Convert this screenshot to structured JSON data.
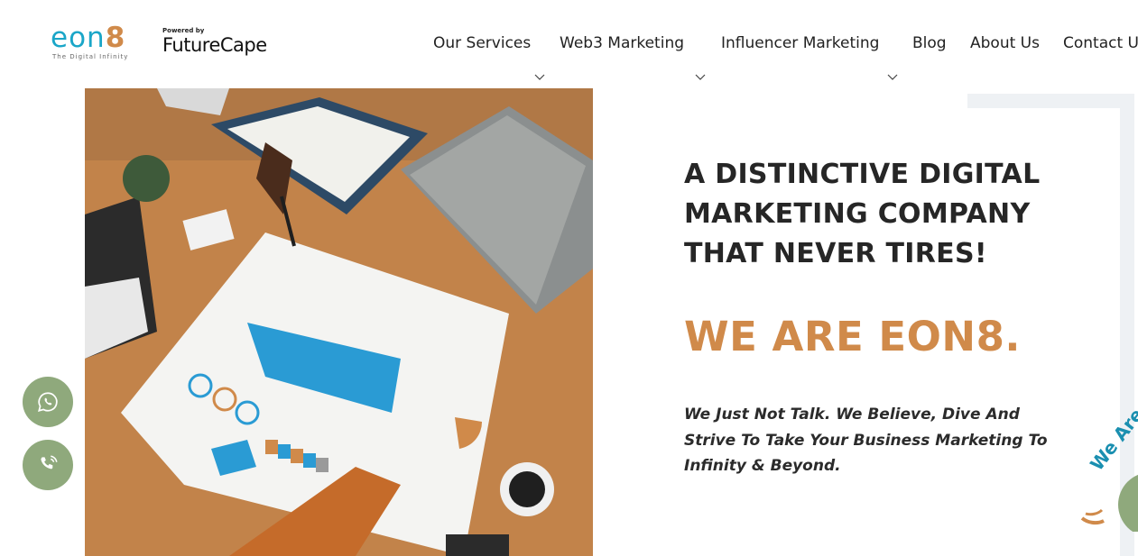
{
  "brand": {
    "logo_text": "eon",
    "logo_digit": "8",
    "logo_tagline": "The Digital Infinity",
    "powered_label": "Powered by",
    "powered_name": "FutureCape"
  },
  "nav": {
    "items": [
      {
        "label": "Our Services",
        "has_dropdown": true
      },
      {
        "label": "Web3 Marketing",
        "has_dropdown": true
      },
      {
        "label": "Influencer Marketing",
        "has_dropdown": true
      },
      {
        "label": "Blog",
        "has_dropdown": false
      },
      {
        "label": "About Us",
        "has_dropdown": false
      },
      {
        "label": "Contact Us",
        "has_dropdown": false
      }
    ]
  },
  "hero": {
    "headline": "A Distinctive Digital Marketing Company That Never Tires!",
    "subhead": "WE ARE EON8.",
    "tagline": "We Just Not Talk. We Believe, Dive And Strive To Take Your Business Marketing To Infinity & Beyond.",
    "badge_text": "We Are"
  },
  "floating": {
    "whatsapp_icon": "whatsapp-icon",
    "phone_icon": "phone-icon"
  },
  "colors": {
    "accent_orange": "#d08a4a",
    "brand_blue": "#1aa6c8",
    "float_green": "#8fa97c",
    "text_dark": "#262626"
  }
}
